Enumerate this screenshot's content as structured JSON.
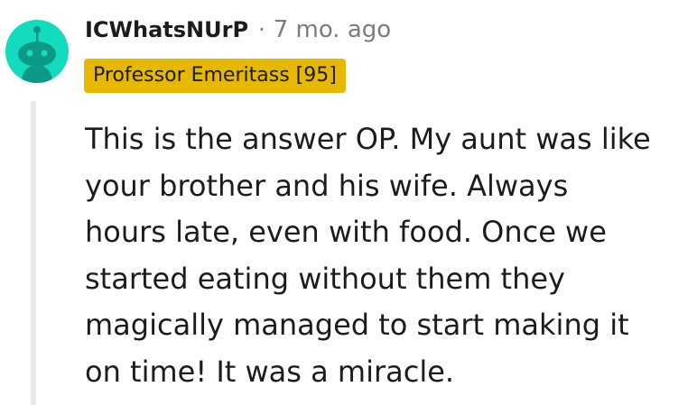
{
  "comment": {
    "username": "ICWhatsNUrP",
    "separator": "·",
    "timestamp": "7 mo. ago",
    "flair": "Professor Emeritass [95]",
    "flair_color": "#e6b800",
    "avatar": {
      "icon": "reddit-snoo-avatar-icon",
      "background_color": "#14dbbe",
      "figure_color": "#0c9a86"
    },
    "body_lines": [
      "This is the answer OP. My aunt was like",
      "your brother and his wife. Always",
      "hours late, even with food. Once we",
      "started eating without them they",
      "magically managed to start making it",
      "on time! It was a miracle."
    ]
  }
}
